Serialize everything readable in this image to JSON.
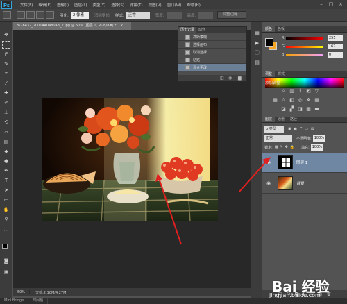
{
  "menubar": {
    "logo": "Ps",
    "items": [
      "文件(F)",
      "编辑(E)",
      "图像(I)",
      "图层(L)",
      "类型(Y)",
      "选择(S)",
      "滤镜(T)",
      "视图(V)",
      "窗口(W)",
      "帮助(H)"
    ],
    "controls": [
      "–",
      "□",
      "×"
    ]
  },
  "options": {
    "feather_label": "羽化:",
    "feather_value": "2 像素",
    "antialias_label": "消除锯齿",
    "style_label": "样式:",
    "style_value": "正常",
    "width_label": "宽度:",
    "height_label": "高度:",
    "refine_button": "调整边缘..."
  },
  "document": {
    "tab_title": "2626432_200144048048_2.jpg @ 50% (图层 1, RGB/8#) *",
    "tab_close": "×",
    "zoom": "50%",
    "doc_info": "文档:2.10M/4.27M"
  },
  "bottom_strip": {
    "mini_bridge": "Mini Bridge",
    "timeline": "时间轴"
  },
  "history": {
    "tabs": [
      "历史记录",
      "动作"
    ],
    "items": [
      "高斯模糊",
      "选择画布",
      "取消选择",
      "粘贴",
      "混合更改"
    ],
    "selected_index": 4
  },
  "color_panel": {
    "tabs": [
      "颜色",
      "色板"
    ],
    "r_label": "R",
    "r_value": "255",
    "g_label": "G",
    "g_value": "162",
    "b_label": "B",
    "b_value": "0",
    "fg_color": "#000000",
    "bg_color": "#f5a623"
  },
  "adjustments": {
    "tabs": [
      "调整",
      "样式"
    ],
    "title": "添加调整"
  },
  "layers": {
    "tabs": [
      "图层",
      "通道",
      "路径"
    ],
    "kind_filter": "ρ 类型",
    "blend_mode": "正常",
    "opacity_label": "不透明度:",
    "opacity_value": "100%",
    "lock_label": "锁定:",
    "fill_label": "填充:",
    "fill_value": "100%",
    "items": [
      {
        "name": "图层 1",
        "selected": true
      },
      {
        "name": "背景",
        "selected": false
      }
    ],
    "footer_icons": [
      "ɕɔ",
      "fx",
      "◘",
      "◐",
      "▭",
      "▤",
      "🗑"
    ]
  },
  "watermark": {
    "logo": "Bai 经验",
    "url": "jingyan.baidu.com"
  }
}
